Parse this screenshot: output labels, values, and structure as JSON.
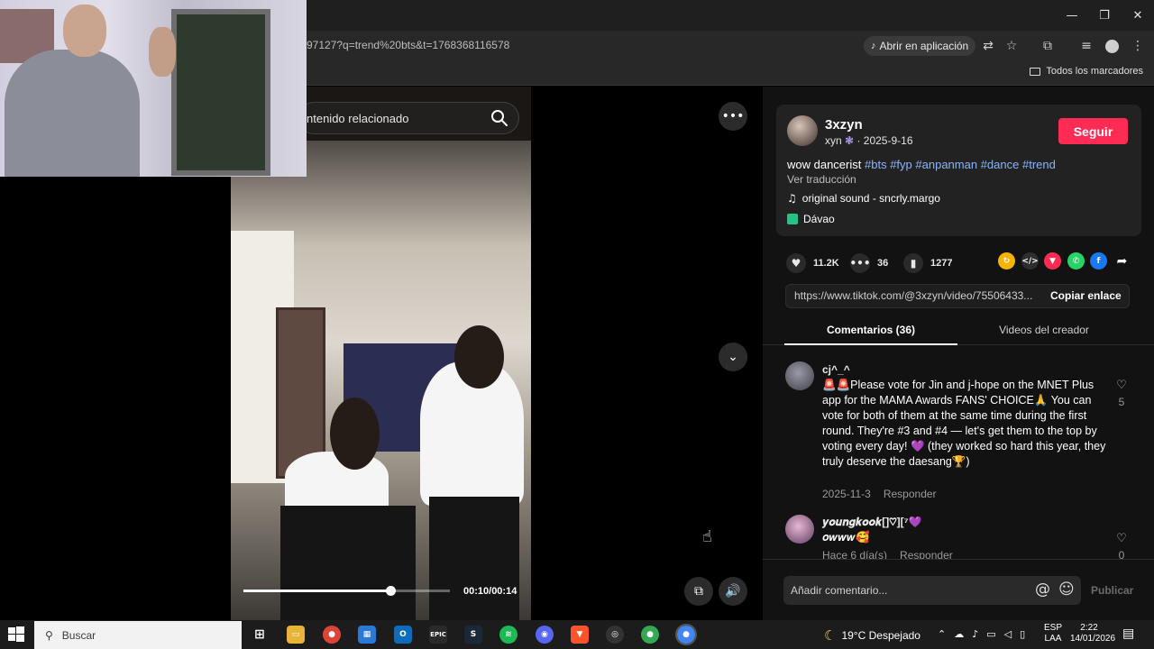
{
  "window": {
    "minimize_glyph": "—",
    "maximize_glyph": "❐",
    "close_glyph": "✕"
  },
  "browser": {
    "url_fragment": "97127?q=trend%20bts&t=1768368116578",
    "open_in_app": "Abrir en aplicación",
    "bookmarks_label": "Todos los marcadores"
  },
  "video": {
    "search_placeholder": "ntenido relacionado",
    "time": "00:10/00:14",
    "progress": 0.71
  },
  "post": {
    "username": "3xzyn",
    "display_name": "xyn",
    "date": "2025-9-16",
    "follow_label": "Seguir",
    "caption_text": "wow dancerist",
    "hashtags": [
      "#bts",
      "#fyp",
      "#anpanman",
      "#dance",
      "#trend"
    ],
    "translate_label": "Ver traducción",
    "sound": "original sound - sncrly.margo",
    "location": "Dávao",
    "likes": "11.2K",
    "comments": "36",
    "saves": "1277",
    "link_url": "https://www.tiktok.com/@3xzyn/video/75506433...",
    "copy_link_label": "Copiar enlace"
  },
  "tabs": {
    "comments": "Comentarios (36)",
    "creator_videos": "Videos del creador"
  },
  "comments": [
    {
      "name": "cj^_^",
      "text": "🚨🚨Please vote for Jin and j-hope on the MNET Plus app for the MAMA Awards FANS' CHOICE🙏 You can vote for both of them at the same time during the first round. They're #3 and #4 — let's get them to the top by voting every day! 💜 (they worked so hard this year, they truly deserve the daesang🏆)",
      "date": "2025-11-3",
      "reply": "Responder",
      "likes": "5"
    },
    {
      "name": "𝒚𝒐𝒖𝒏𝒈𝒌𝒐𝒐𝒌[]♡][⁷💜",
      "text": "𝒐𝒘𝒘𝒘🥰",
      "date": "Hace 6 día(s)",
      "reply": "Responder",
      "likes": "0"
    }
  ],
  "comment_box": {
    "placeholder": "Añadir comentario...",
    "publish": "Publicar"
  },
  "taskbar": {
    "search": "Buscar",
    "weather": "19°C  Despejado",
    "lang_line1": "ESP",
    "lang_line2": "LAA",
    "time": "2:22",
    "date": "14/01/2026"
  },
  "colors": {
    "accent": "#fe2c55",
    "hashtag": "#8ab4f8",
    "panel": "#121212"
  }
}
